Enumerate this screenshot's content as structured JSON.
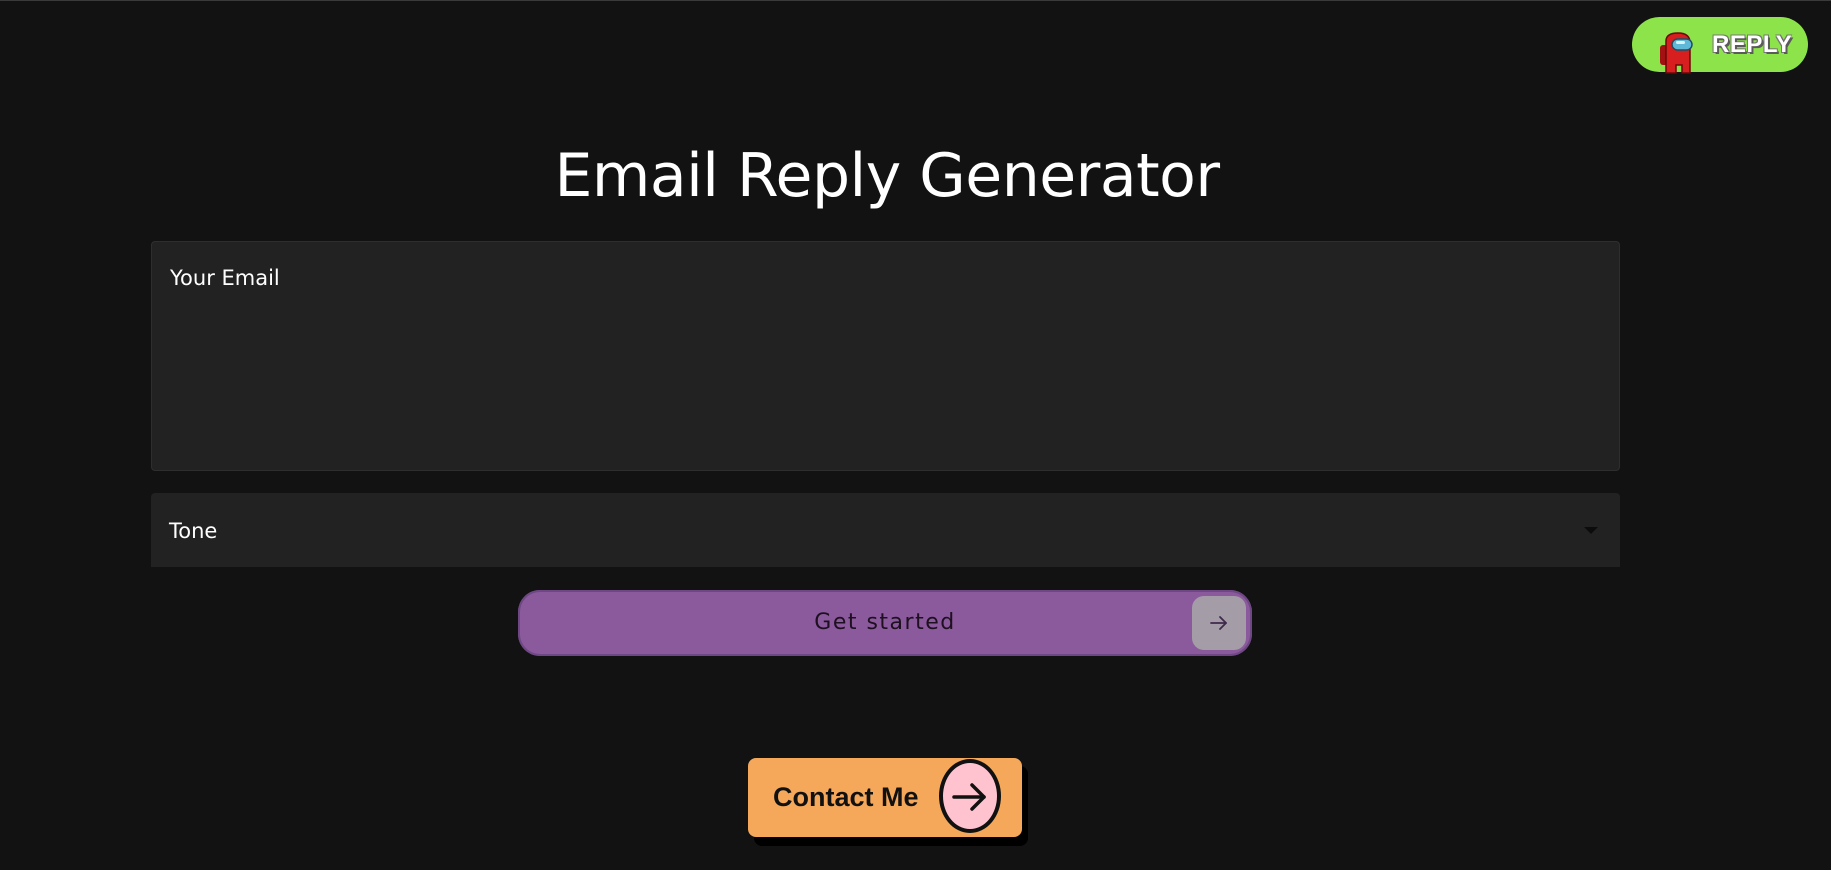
{
  "header": {
    "reply_badge": {
      "label": "REPLY",
      "icon": "crewmate-icon",
      "bg_color": "#8de44a"
    }
  },
  "main": {
    "title": "Email Reply Generator",
    "email_field": {
      "label": "Your Email",
      "value": ""
    },
    "tone_select": {
      "label": "Tone",
      "selected_value": "",
      "icon": "dropdown-caret-icon"
    },
    "get_started_button": {
      "label": "Get started",
      "icon": "arrow-right-icon",
      "bg_color": "#8a5a9c"
    }
  },
  "footer": {
    "contact_button": {
      "label": "Contact Me",
      "icon": "arrow-right-icon",
      "bg_color": "#f5a85a",
      "circle_color": "#ffc3cf"
    }
  },
  "colors": {
    "background": "#121212",
    "field_bg": "#222222",
    "text": "#ffffff"
  }
}
